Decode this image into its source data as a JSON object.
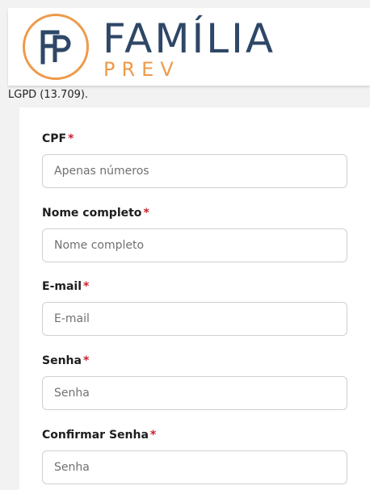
{
  "header": {
    "brand_main": "FAMÍLIA",
    "brand_sub": "PREV",
    "colors": {
      "navy": "#2e4767",
      "orange": "#ee9a4a"
    }
  },
  "notice_text": "LGPD (13.709).",
  "form": {
    "required_mark": "*",
    "fields": [
      {
        "label": "CPF",
        "placeholder": "Apenas números",
        "value": ""
      },
      {
        "label": "Nome completo",
        "placeholder": "Nome completo",
        "value": ""
      },
      {
        "label": "E-mail",
        "placeholder": "E-mail",
        "value": ""
      },
      {
        "label": "Senha",
        "placeholder": "Senha",
        "value": ""
      },
      {
        "label": "Confirmar Senha",
        "placeholder": "Senha",
        "value": ""
      }
    ]
  }
}
